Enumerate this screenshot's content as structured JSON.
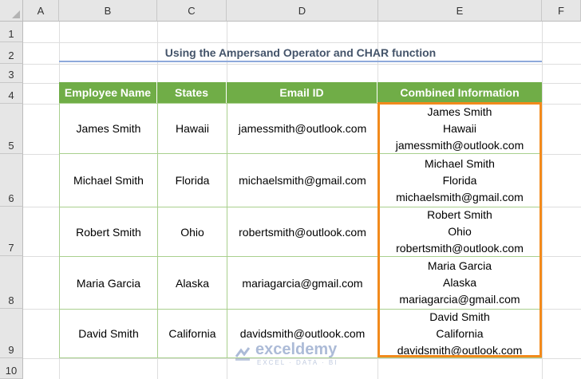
{
  "sheet": {
    "columns": [
      "A",
      "B",
      "C",
      "D",
      "E",
      "F"
    ],
    "rows": [
      "1",
      "2",
      "3",
      "4",
      "5",
      "6",
      "7",
      "8",
      "9",
      "10"
    ]
  },
  "title": "Using the Ampersand Operator and CHAR function",
  "table": {
    "headers": [
      "Employee Name",
      "States",
      "Email ID",
      "Combined Information"
    ],
    "rows": [
      {
        "name": "James Smith",
        "state": "Hawaii",
        "email": "jamessmith@outlook.com",
        "combined": [
          "James Smith",
          "Hawaii",
          "jamessmith@outlook.com"
        ]
      },
      {
        "name": "Michael Smith",
        "state": "Florida",
        "email": "michaelsmith@gmail.com",
        "combined": [
          "Michael Smith",
          "Florida",
          "michaelsmith@gmail.com"
        ]
      },
      {
        "name": "Robert Smith",
        "state": "Ohio",
        "email": "robertsmith@outlook.com",
        "combined": [
          "Robert Smith",
          "Ohio",
          "robertsmith@outlook.com"
        ]
      },
      {
        "name": "Maria Garcia",
        "state": "Alaska",
        "email": "mariagarcia@gmail.com",
        "combined": [
          "Maria Garcia",
          "Alaska",
          "mariagarcia@gmail.com"
        ]
      },
      {
        "name": "David Smith",
        "state": "California",
        "email": "davidsmith@outlook.com",
        "combined": [
          "David Smith",
          "California",
          "davidsmith@outlook.com"
        ]
      }
    ]
  },
  "watermark": {
    "name": "exceldemy",
    "tagline": "EXCEL · DATA · BI"
  },
  "colors": {
    "header_green": "#70ad47",
    "highlight_orange": "#f28a1c",
    "title_text": "#44546a"
  }
}
